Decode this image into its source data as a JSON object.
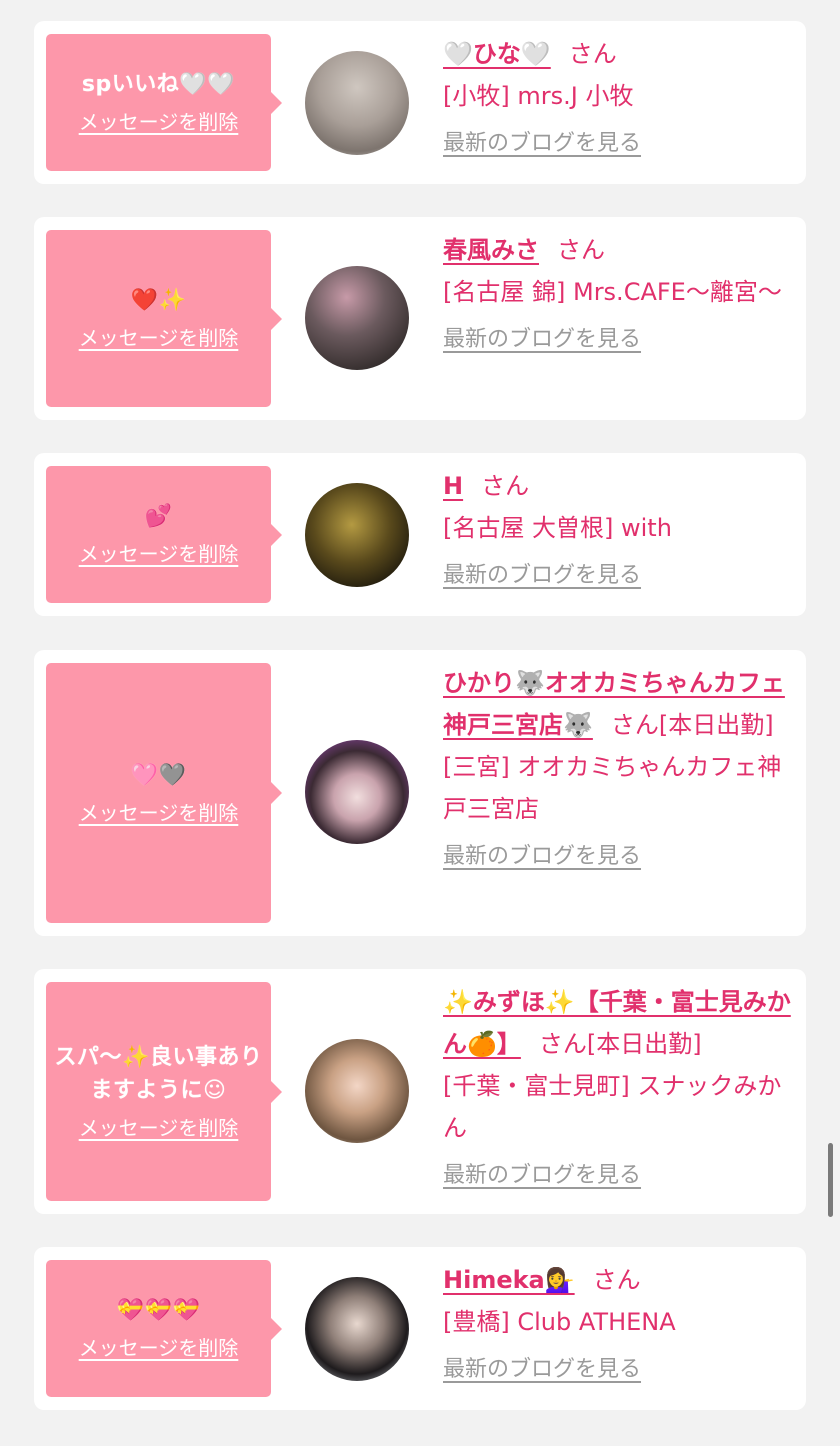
{
  "common": {
    "delete_label": "メッセージを削除",
    "blog_label": "最新のブログを見る",
    "san": "さん"
  },
  "items": [
    {
      "message": "spいいね🤍🤍",
      "name": "🤍ひな🤍",
      "suffix": "さん",
      "shop": "[小牧] mrs.J 小牧"
    },
    {
      "message": "❤️✨",
      "name": "春風みさ",
      "suffix": "さん",
      "shop": "[名古屋 錦] Mrs.CAFE〜離宮〜"
    },
    {
      "message": "💕",
      "name": "H",
      "suffix": "さん",
      "shop": "[名古屋 大曽根] with"
    },
    {
      "message": "🩷🩶",
      "name": "ひかり🐺オオカミちゃんカフェ神戸三宮店🐺",
      "suffix": "さん[本日出勤]",
      "shop": "[三宮] オオカミちゃんカフェ神戸三宮店"
    },
    {
      "message": "スパ〜✨良い事ありますように☺︎",
      "name": "✨みずほ✨【千葉・富士見みかん🍊】",
      "suffix": "さん[本日出勤]",
      "shop": "[千葉・富士見町] スナックみかん"
    },
    {
      "message": "💝💝💝",
      "name": "Himeka💁‍♀️",
      "suffix": "さん",
      "shop": "[豊橋] Club ATHENA"
    }
  ],
  "colors": {
    "bubble": "#fd97aa",
    "accent": "#e1306c",
    "muted": "#9a9a9a",
    "background": "#f2f2f2"
  }
}
